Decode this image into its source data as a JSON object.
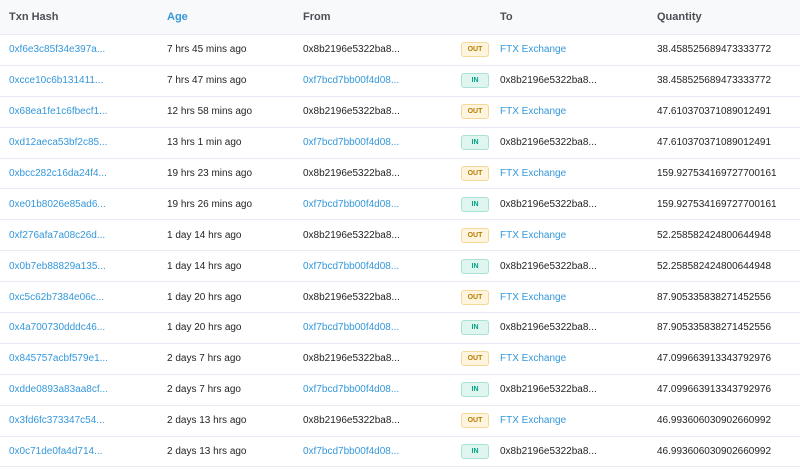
{
  "columns": {
    "hash": "Txn Hash",
    "age": "Age",
    "from": "From",
    "to": "To",
    "quantity": "Quantity"
  },
  "colors": {
    "link": "#3498db",
    "out_text": "#b47d00",
    "out_bg": "#fff4dd",
    "in_text": "#00a186",
    "in_bg": "#dff5ef"
  },
  "rows": [
    {
      "hash": "0xf6e3c85f34e397a...",
      "age": "7 hrs 45 mins ago",
      "from": "0x8b2196e5322ba8...",
      "dir": "OUT",
      "to": "FTX Exchange",
      "qty": "38.458525689473333772"
    },
    {
      "hash": "0xcce10c6b131411...",
      "age": "7 hrs 47 mins ago",
      "from": "0xf7bcd7bb00f4d08...",
      "dir": "IN",
      "to": "0x8b2196e5322ba8...",
      "qty": "38.458525689473333772"
    },
    {
      "hash": "0x68ea1fe1c6fbecf1...",
      "age": "12 hrs 58 mins ago",
      "from": "0x8b2196e5322ba8...",
      "dir": "OUT",
      "to": "FTX Exchange",
      "qty": "47.610370371089012491"
    },
    {
      "hash": "0xd12aeca53bf2c85...",
      "age": "13 hrs 1 min ago",
      "from": "0xf7bcd7bb00f4d08...",
      "dir": "IN",
      "to": "0x8b2196e5322ba8...",
      "qty": "47.610370371089012491"
    },
    {
      "hash": "0xbcc282c16da24f4...",
      "age": "19 hrs 23 mins ago",
      "from": "0x8b2196e5322ba8...",
      "dir": "OUT",
      "to": "FTX Exchange",
      "qty": "159.927534169727700161"
    },
    {
      "hash": "0xe01b8026e85ad6...",
      "age": "19 hrs 26 mins ago",
      "from": "0xf7bcd7bb00f4d08...",
      "dir": "IN",
      "to": "0x8b2196e5322ba8...",
      "qty": "159.927534169727700161"
    },
    {
      "hash": "0xf276afa7a08c26d...",
      "age": "1 day 14 hrs ago",
      "from": "0x8b2196e5322ba8...",
      "dir": "OUT",
      "to": "FTX Exchange",
      "qty": "52.258582424800644948"
    },
    {
      "hash": "0x0b7eb88829a135...",
      "age": "1 day 14 hrs ago",
      "from": "0xf7bcd7bb00f4d08...",
      "dir": "IN",
      "to": "0x8b2196e5322ba8...",
      "qty": "52.258582424800644948"
    },
    {
      "hash": "0xc5c62b7384e06c...",
      "age": "1 day 20 hrs ago",
      "from": "0x8b2196e5322ba8...",
      "dir": "OUT",
      "to": "FTX Exchange",
      "qty": "87.905335838271452556"
    },
    {
      "hash": "0x4a700730dddc46...",
      "age": "1 day 20 hrs ago",
      "from": "0xf7bcd7bb00f4d08...",
      "dir": "IN",
      "to": "0x8b2196e5322ba8...",
      "qty": "87.905335838271452556"
    },
    {
      "hash": "0x845757acbf579e1...",
      "age": "2 days 7 hrs ago",
      "from": "0x8b2196e5322ba8...",
      "dir": "OUT",
      "to": "FTX Exchange",
      "qty": "47.099663913343792976"
    },
    {
      "hash": "0xdde0893a83aa8cf...",
      "age": "2 days 7 hrs ago",
      "from": "0xf7bcd7bb00f4d08...",
      "dir": "IN",
      "to": "0x8b2196e5322ba8...",
      "qty": "47.099663913343792976"
    },
    {
      "hash": "0x3fd6fc373347c54...",
      "age": "2 days 13 hrs ago",
      "from": "0x8b2196e5322ba8...",
      "dir": "OUT",
      "to": "FTX Exchange",
      "qty": "46.993606030902660992"
    },
    {
      "hash": "0x0c71de0fa4d714...",
      "age": "2 days 13 hrs ago",
      "from": "0xf7bcd7bb00f4d08...",
      "dir": "IN",
      "to": "0x8b2196e5322ba8...",
      "qty": "46.993606030902660992"
    }
  ]
}
